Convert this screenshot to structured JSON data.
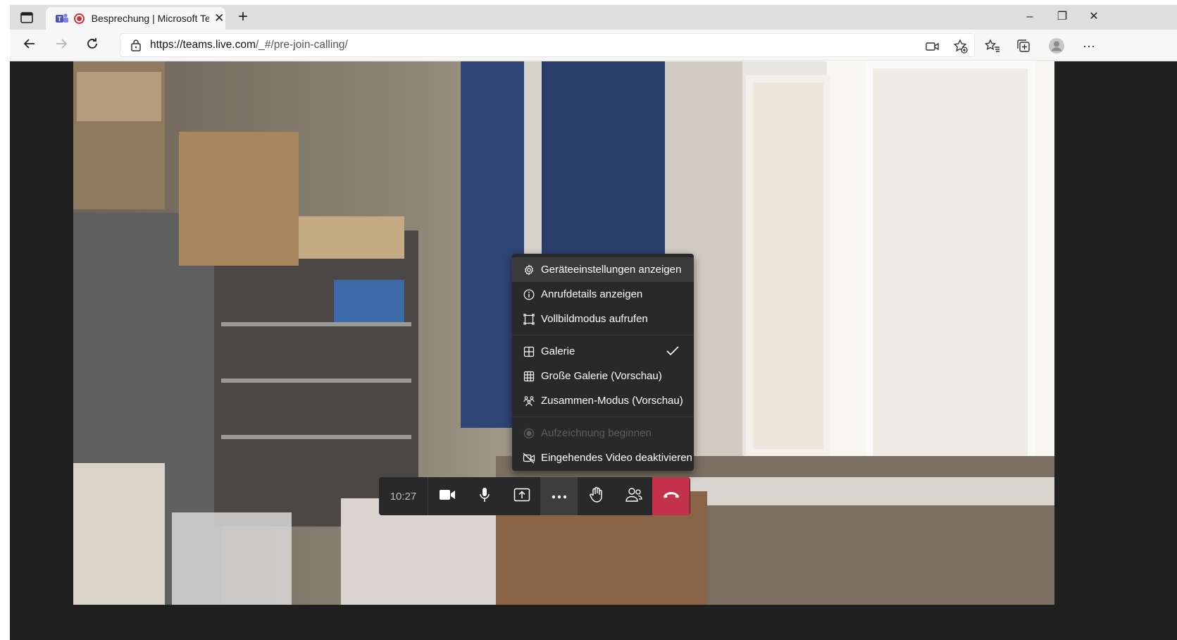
{
  "browser": {
    "tab": {
      "title": "Besprechung | Microsoft Teams",
      "icon": "teams-logo",
      "recording_indicator": "record-icon"
    },
    "new_tab_label": "+",
    "window_controls": {
      "minimize": "–",
      "restore": "❐",
      "close": "✕"
    },
    "address": {
      "url_host": "https://teams.live.com",
      "url_path": "/_#/pre-join-calling/"
    },
    "icons": [
      "back-icon",
      "forward-icon",
      "refresh-icon",
      "lock-icon",
      "camera-permission-icon",
      "add-favorite-icon",
      "favorites-icon",
      "collections-icon",
      "profile-icon",
      "more-icon"
    ],
    "more_label": "···"
  },
  "call": {
    "timer": "10:27",
    "controls": [
      "camera-icon",
      "microphone-icon",
      "share-screen-icon",
      "more-actions-icon",
      "raise-hand-icon",
      "participants-icon",
      "hang-up-icon"
    ]
  },
  "more_menu": {
    "items": [
      {
        "label": "Geräteeinstellungen anzeigen",
        "icon": "gear-icon",
        "state": "hover"
      },
      {
        "label": "Anrufdetails anzeigen",
        "icon": "info-icon"
      },
      {
        "label": "Vollbildmodus aufrufen",
        "icon": "fullscreen-icon"
      },
      {
        "label": "Galerie",
        "icon": "grid-icon",
        "checked": true
      },
      {
        "label": "Große Galerie (Vorschau)",
        "icon": "large-grid-icon"
      },
      {
        "label": "Zusammen-Modus (Vorschau)",
        "icon": "together-mode-icon"
      },
      {
        "label": "Aufzeichnung beginnen",
        "icon": "record-icon",
        "disabled": true
      },
      {
        "label": "Eingehendes Video deaktivieren",
        "icon": "video-off-icon"
      }
    ]
  },
  "colors": {
    "accent_hangup": "#c4314b",
    "menu_bg": "#292929",
    "recording": "#d13438"
  }
}
